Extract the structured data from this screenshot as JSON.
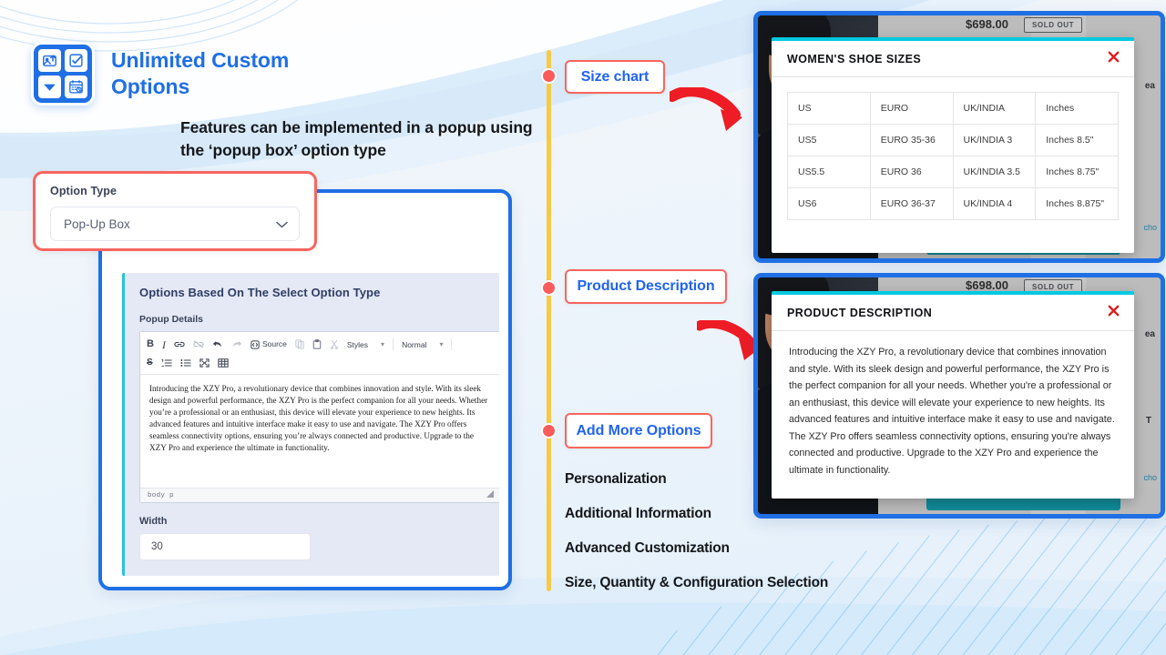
{
  "brand": {
    "title": "Unlimited Custom Options",
    "icons": [
      "image-upload-icon",
      "checkbox-icon",
      "dropdown-arrow-icon",
      "calendar-clock-icon"
    ],
    "accent_color": "#1f6fe5"
  },
  "subheading": "Features can be implemented in a popup using the ‘popup box’ option type",
  "option_type_card": {
    "label": "Option Type",
    "selected_value": "Pop-Up Box",
    "border_color": "#f9655f"
  },
  "builder_panel": {
    "title": "Options Based On The Select Option Type",
    "popup_details_label": "Popup Details",
    "editor": {
      "toolbar_row1": [
        "B",
        "I",
        "link-icon",
        "unlink-icon",
        "undo-icon",
        "redo-icon",
        "Source",
        "copy-icon",
        "paste-icon",
        "cut-icon"
      ],
      "styles_dropdown": "Styles",
      "format_dropdown": "Normal",
      "toolbar_row2": [
        "strikethrough-icon",
        "numbered-list-icon",
        "bulleted-list-icon",
        "maximize-icon",
        "table-icon"
      ],
      "content": "Introducing the XZY Pro, a revolutionary device that combines innovation and style. With its sleek design and powerful performance, the XZY Pro is the perfect companion for all your needs. Whether you’re a professional or an enthusiast, this device will elevate your experience to new heights. Its advanced features and intuitive interface make it easy to use and navigate. The XZY Pro offers seamless connectivity options, ensuring you’re always connected and productive. Upgrade to the XZY Pro and experience the ultimate in functionality.",
      "status_path": "body  p"
    },
    "width_label": "Width",
    "width_value": "30"
  },
  "timeline": {
    "line_color": "#f7ca45",
    "dot_color": "#fb5b5b",
    "tags": [
      {
        "label": "Size chart"
      },
      {
        "label": "Product Description"
      },
      {
        "label": "Add More Options"
      }
    ],
    "list_items": [
      "Personalization",
      "Additional Information",
      "Advanced Customization",
      "Size, Quantity & Configuration Selection"
    ]
  },
  "shop_card_top": {
    "price": "$698.00",
    "sold_out": "SOLD OUT",
    "side_text": "ea",
    "link_text": "cho"
  },
  "shop_card_bottom": {
    "price": "$698.00",
    "sold_out": "SOLD OUT",
    "side_text": "ea",
    "link_text": "cho",
    "side_letter": "T"
  },
  "modal_size_chart": {
    "title": "WOMEN'S SHOE SIZES",
    "close_icon": "close-icon",
    "columns": [
      "US",
      "EURO",
      "UK/INDIA",
      "Inches"
    ],
    "rows": [
      [
        "US5",
        "EURO 35-36",
        "UK/INDIA 3",
        "Inches 8.5\""
      ],
      [
        "US5.5",
        "EURO 36",
        "UK/INDIA 3.5",
        "Inches 8.75\""
      ],
      [
        "US6",
        "EURO 36-37",
        "UK/INDIA 4",
        "Inches 8.875\""
      ]
    ]
  },
  "modal_product_description": {
    "title": "PRODUCT DESCRIPTION",
    "close_icon": "close-icon",
    "body": "Introducing the XZY Pro, a revolutionary device that combines innovation and style. With its sleek design and powerful performance, the XZY Pro is the perfect companion for all your needs. Whether you're a professional or an enthusiast, this device will elevate your experience to new heights. Its advanced features and intuitive interface make it easy to use and navigate. The XZY Pro offers seamless connectivity options, ensuring you're always connected and productive. Upgrade to the XZY Pro and experience the ultimate in functionality."
  }
}
